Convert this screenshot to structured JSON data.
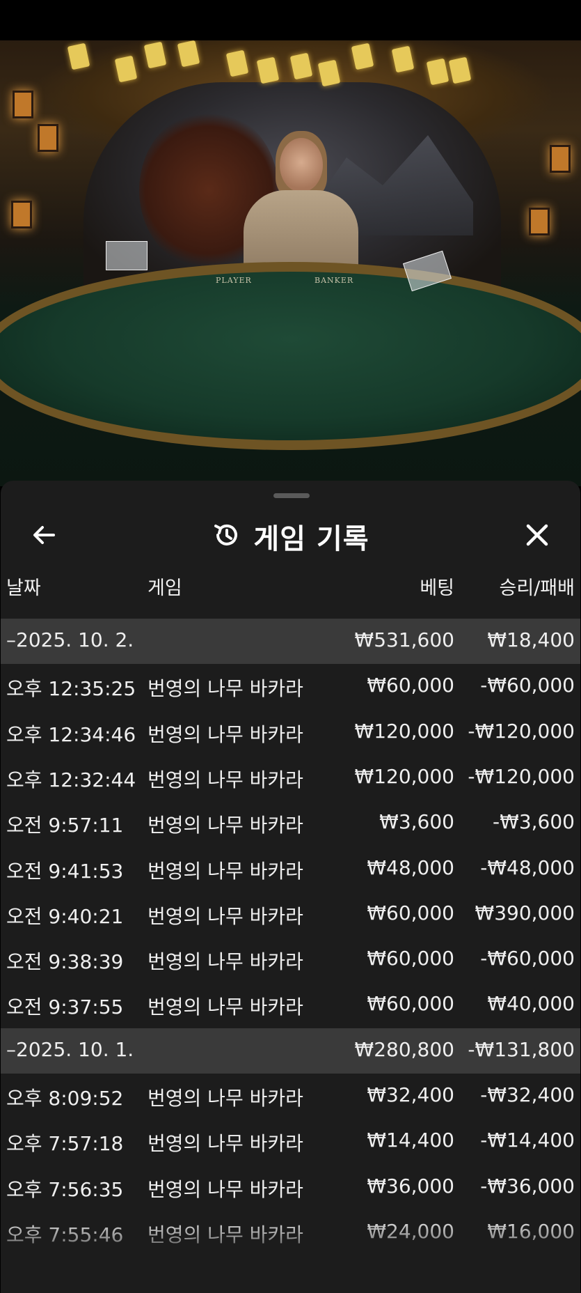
{
  "video": {
    "table_labels": {
      "player": "PLAYER",
      "banker": "BANKER"
    }
  },
  "panel": {
    "title": "게임 기록",
    "icons": {
      "back": "arrow-left-icon",
      "history": "history-icon",
      "close": "close-icon"
    }
  },
  "columns": {
    "date": "날짜",
    "game": "게임",
    "bet": "베팅",
    "result": "승리/패배"
  },
  "groups": [
    {
      "date": "–2025. 10. 2.",
      "bet_total": "₩531,600",
      "result_total": "₩18,400",
      "rows": [
        {
          "time": "오후 12:35:25",
          "game": "번영의 나무 바카라",
          "bet": "₩60,000",
          "result": "-₩60,000"
        },
        {
          "time": "오후 12:34:46",
          "game": "번영의 나무 바카라",
          "bet": "₩120,000",
          "result": "-₩120,000"
        },
        {
          "time": "오후 12:32:44",
          "game": "번영의 나무 바카라",
          "bet": "₩120,000",
          "result": "-₩120,000"
        },
        {
          "time": "오전 9:57:11",
          "game": "번영의 나무 바카라",
          "bet": "₩3,600",
          "result": "-₩3,600"
        },
        {
          "time": "오전 9:41:53",
          "game": "번영의 나무 바카라",
          "bet": "₩48,000",
          "result": "-₩48,000"
        },
        {
          "time": "오전 9:40:21",
          "game": "번영의 나무 바카라",
          "bet": "₩60,000",
          "result": "₩390,000"
        },
        {
          "time": "오전 9:38:39",
          "game": "번영의 나무 바카라",
          "bet": "₩60,000",
          "result": "-₩60,000"
        },
        {
          "time": "오전 9:37:55",
          "game": "번영의 나무 바카라",
          "bet": "₩60,000",
          "result": "₩40,000"
        }
      ]
    },
    {
      "date": "–2025. 10. 1.",
      "bet_total": "₩280,800",
      "result_total": "-₩131,800",
      "rows": [
        {
          "time": "오후 8:09:52",
          "game": "번영의 나무 바카라",
          "bet": "₩32,400",
          "result": "-₩32,400"
        },
        {
          "time": "오후 7:57:18",
          "game": "번영의 나무 바카라",
          "bet": "₩14,400",
          "result": "-₩14,400"
        },
        {
          "time": "오후 7:56:35",
          "game": "번영의 나무 바카라",
          "bet": "₩36,000",
          "result": "-₩36,000"
        },
        {
          "time": "오후 7:55:46",
          "game": "번영의 나무 바카라",
          "bet": "₩24,000",
          "result": "₩16,000"
        }
      ]
    }
  ]
}
